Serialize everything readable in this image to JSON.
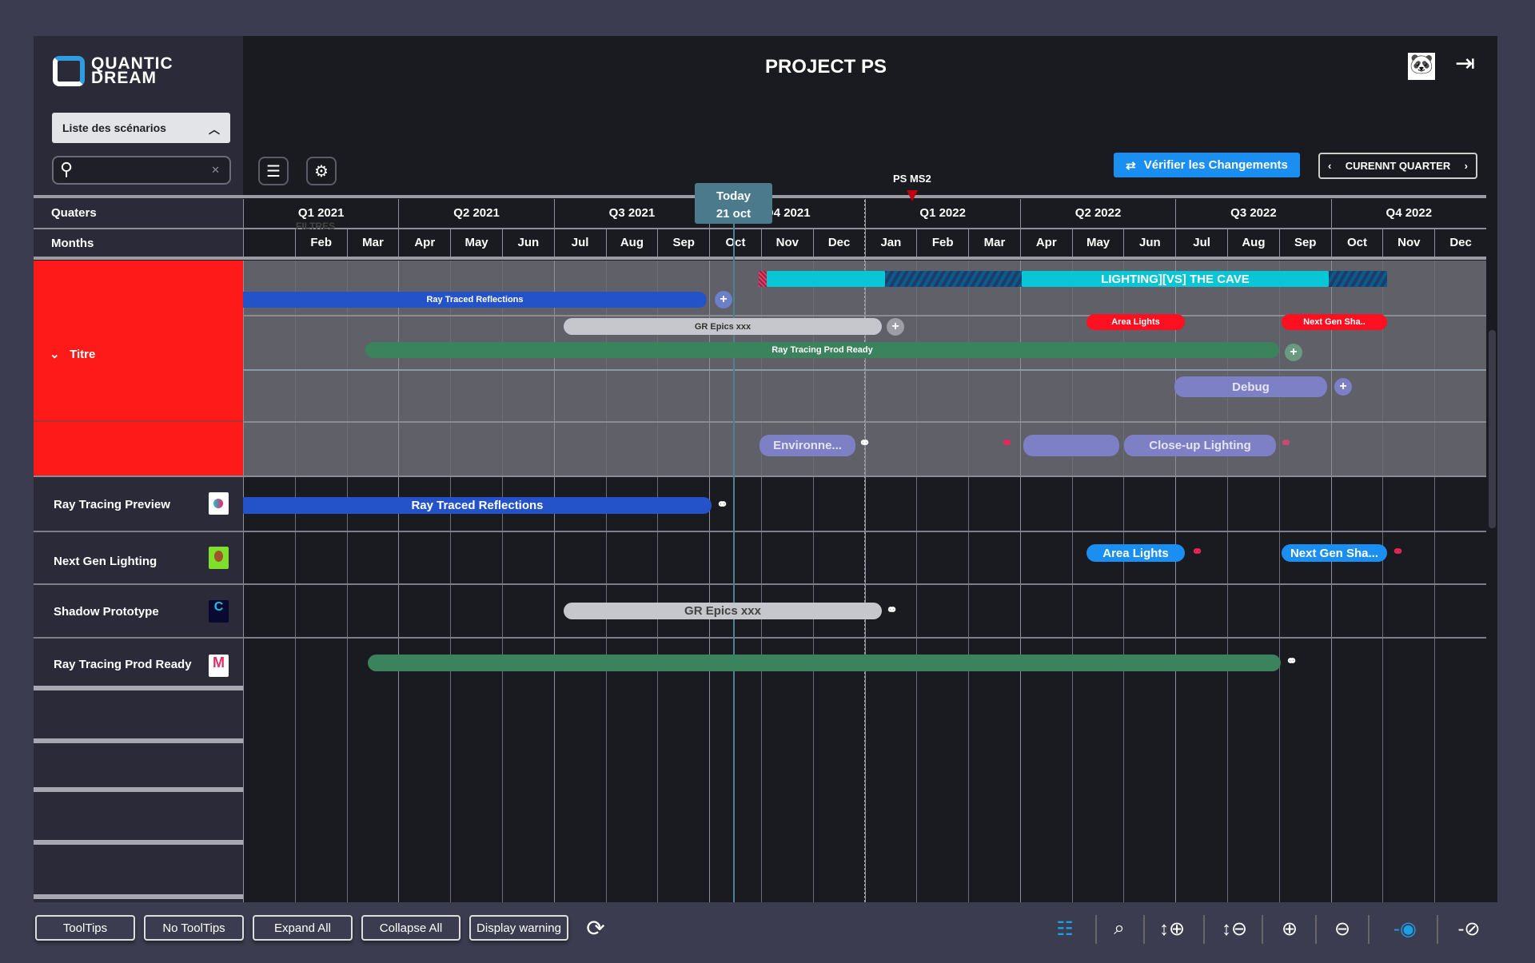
{
  "app": {
    "logo_text": [
      "QUANTIC",
      "DREAM"
    ],
    "title": "PROJECT PS"
  },
  "sidebar": {
    "scenario_dropdown": "Liste des scénarios",
    "search": {
      "value": "",
      "placeholder": ""
    },
    "quarters_label": "Quaters",
    "months_label": "Months",
    "group": {
      "label": "Titre",
      "color": "#ff1a1a"
    },
    "rows": [
      {
        "label": "Ray Tracing Preview"
      },
      {
        "label": "Next Gen Lighting"
      },
      {
        "label": "Shadow Prototype"
      },
      {
        "label": "Ray Tracing Prod Ready"
      }
    ]
  },
  "toolbar": {
    "verify_label": "Vérifier les Changements",
    "period_label": "CURENNT QUARTER",
    "filters_ghost": "FILTRES"
  },
  "timeline": {
    "quarters": [
      "Q1 2021",
      "Q2 2021",
      "Q3 2021",
      "Q4 2021",
      "Q1 2022",
      "Q2 2022",
      "Q3 2022",
      "Q4 2022"
    ],
    "months": [
      "",
      "Feb",
      "Mar",
      "Apr",
      "May",
      "Jun",
      "Jul",
      "Aug",
      "Sep",
      "Oct",
      "Nov",
      "Dec",
      "Jan",
      "Feb",
      "Mar",
      "Apr",
      "May",
      "Jun",
      "Jul",
      "Aug",
      "Sep",
      "Oct",
      "Nov",
      "Dec"
    ],
    "today": {
      "label": "Today",
      "date": "21 oct"
    },
    "milestone": {
      "label": "PS MS2",
      "color": "#c0000f"
    }
  },
  "group_bars": {
    "lighting": "LIGHTING][VS] THE CAVE",
    "ray_traced": "Ray Traced Reflections",
    "gr_epics": "GR Epics xxx",
    "area_lights": "Area Lights",
    "next_gen": "Next Gen Sha..",
    "prod_ready": "Ray Tracing Prod Ready",
    "debug": "Debug",
    "environ": "Environne...",
    "blank": "",
    "closeup": "Close-up Lighting"
  },
  "row_bars": {
    "ray_traced": "Ray Traced Reflections",
    "area_lights": "Area Lights",
    "next_gen": "Next Gen Sha...",
    "gr_epics": "GR Epics xxx",
    "prod_ready": ""
  },
  "colors": {
    "blue": "#2452c8",
    "cyan": "#08c6d6",
    "gray_bar": "#c6c7cc",
    "red": "#ff1020",
    "green": "#3a835d",
    "purple": "#7e80c6",
    "light_blue": "#1b8ef2"
  },
  "bottom": {
    "buttons": [
      "ToolTips",
      "No ToolTips",
      "Expand All",
      "Collapse All",
      "Display warning"
    ],
    "icons": [
      "list-view-icon",
      "zoom-fit-icon",
      "vertical-zoom-in-icon",
      "vertical-zoom-out-icon",
      "horizontal-zoom-in-icon",
      "horizontal-zoom-out-icon",
      "show-icon",
      "hide-icon"
    ]
  }
}
